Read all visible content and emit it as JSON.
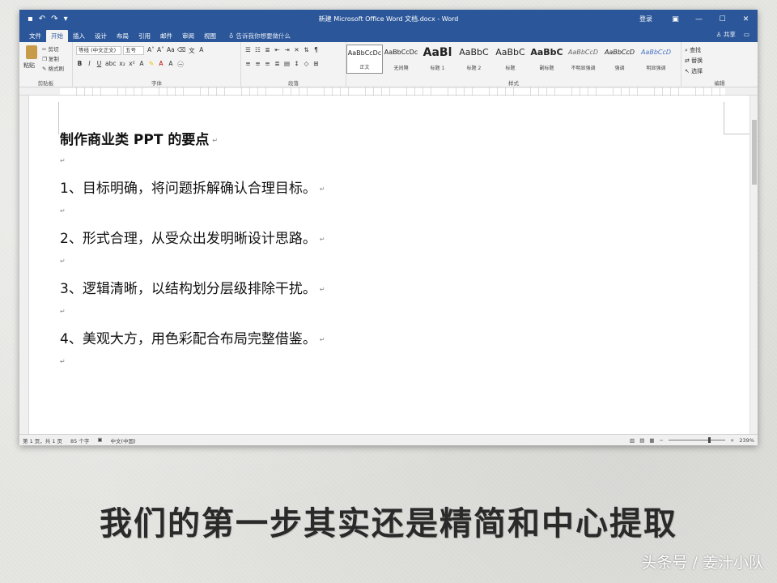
{
  "window": {
    "title": "新建 Microsoft Office Word 文档.docx - Word",
    "login_label": "登录",
    "min_icon": "minimize-icon",
    "max_icon": "maximize-icon",
    "close_icon": "close-icon"
  },
  "tabs": [
    "文件",
    "开始",
    "插入",
    "设计",
    "布局",
    "引用",
    "邮件",
    "审阅",
    "视图"
  ],
  "active_tab": "开始",
  "tell_me": "告诉我你想要做什么",
  "share_label": "共享",
  "ribbon": {
    "clipboard": {
      "paste": "粘贴",
      "cut": "剪切",
      "copy": "复制",
      "format_painter": "格式刷",
      "label": "剪贴板"
    },
    "font": {
      "font_name": "等线 (中文正文)",
      "font_size": "五号",
      "label": "字体"
    },
    "paragraph": {
      "label": "段落"
    },
    "styles": {
      "label": "样式",
      "items": [
        {
          "sample": "AaBbCcDc",
          "name": "正文"
        },
        {
          "sample": "AaBbCcDc",
          "name": "无间隔"
        },
        {
          "sample": "AaBl",
          "name": "标题 1"
        },
        {
          "sample": "AaBbC",
          "name": "标题 2"
        },
        {
          "sample": "AaBbC",
          "name": "标题"
        },
        {
          "sample": "AaBbC",
          "name": "副标题"
        },
        {
          "sample": "AaBbCcD",
          "name": "不明显强调"
        },
        {
          "sample": "AaBbCcD",
          "name": "强调"
        },
        {
          "sample": "AaBbCcD",
          "name": "明显强调"
        }
      ]
    },
    "editing": {
      "label": "编辑",
      "find": "查找",
      "replace": "替换",
      "select": "选择"
    }
  },
  "document": {
    "title": "制作商业类 PPT 的要点",
    "items": [
      "1、目标明确，将问题拆解确认合理目标。",
      "2、形式合理，从受众出发明晰设计思路。",
      "3、逻辑清晰，以结构划分层级排除干扰。",
      "4、美观大方，用色彩配合布局完整借鉴。"
    ]
  },
  "status": {
    "page": "第 1 页，共 1 页",
    "words": "85 个字",
    "language": "中文(中国)",
    "zoom": "239%",
    "zoom_level": 0.7
  },
  "caption": "我们的第一步其实还是精简和中心提取",
  "watermark": "头条号 / 姜汁小队"
}
